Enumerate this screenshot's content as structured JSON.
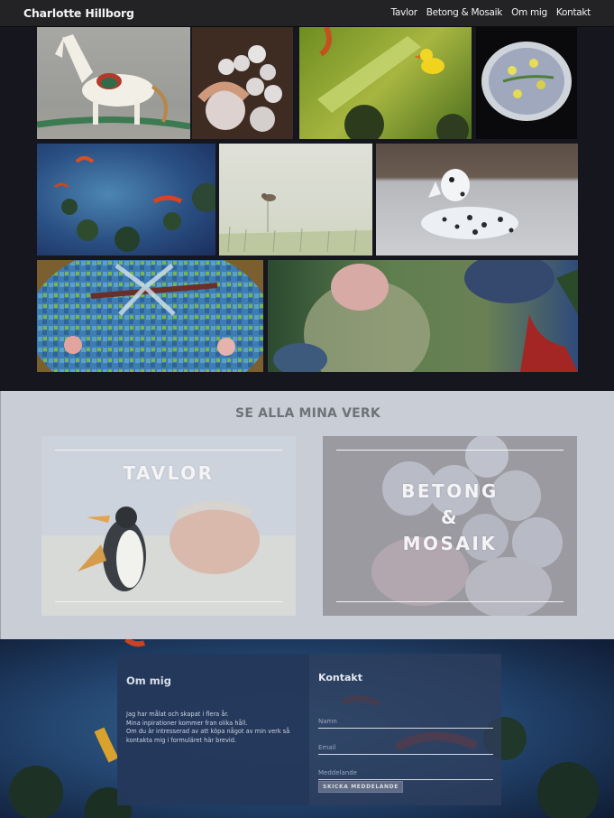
{
  "site": {
    "brand": "Charlotte Hillborg"
  },
  "nav": {
    "items": [
      "Tavlor",
      "Betong & Mosaik",
      "Om mig",
      "Kontakt"
    ]
  },
  "gallery": {
    "items": [
      "rocking-horse-painting",
      "doll-heads-sculpture",
      "lily-pad-duck-painting",
      "mosaic-plate",
      "koi-pond-painting",
      "meadow-bird-painting",
      "dalmatian-sculpture",
      "dragonfly-mosaic",
      "woman-in-pond-painting"
    ]
  },
  "works": {
    "heading": "SE ALLA MINA VERK",
    "cards": [
      {
        "lines": [
          "TAVLOR"
        ]
      },
      {
        "lines": [
          "BETONG",
          "&",
          "MOSAIK"
        ]
      }
    ]
  },
  "about": {
    "heading": "Om mig",
    "lines": [
      "Jag har målat och skapat i flera år.",
      "Mina inpirationer kommer fran olika håll.",
      "Om du är intresserad av att köpa något av min verk så kontakta mig i formuläret här brevid."
    ]
  },
  "contact": {
    "heading": "Kontakt",
    "name_placeholder": "Namn",
    "email_placeholder": "Email",
    "message_placeholder": "Meddelande",
    "send_label": "SKICKA MEDDELANDE"
  }
}
